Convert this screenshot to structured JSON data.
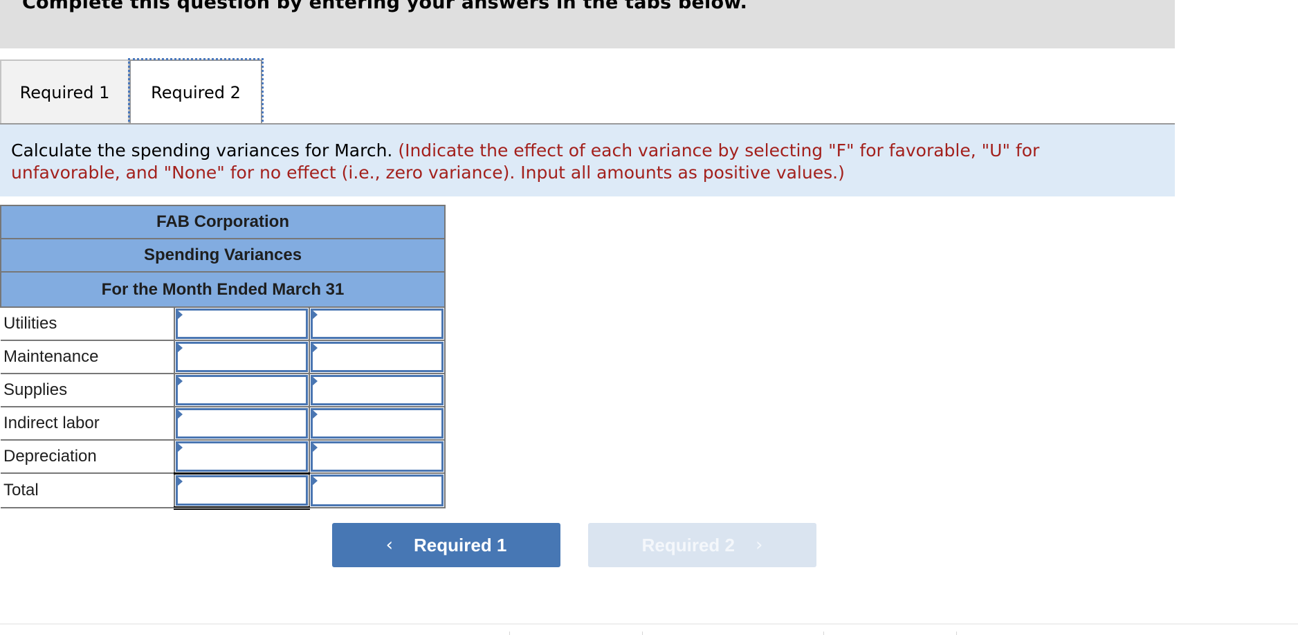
{
  "banner": {
    "title": "Complete this question by entering your answers in the tabs below."
  },
  "tabs": [
    {
      "label": "Required 1",
      "active": false
    },
    {
      "label": "Required 2",
      "active": true
    }
  ],
  "instruction": {
    "main": "Calculate the spending variances for March.",
    "hint": "(Indicate the effect of each variance by selecting \"F\" for favorable, \"U\" for unfavorable, and \"None\" for no effect (i.e., zero variance). Input all amounts as positive values.)"
  },
  "report": {
    "company": "FAB Corporation",
    "title": "Spending Variances",
    "period": "For the Month Ended March 31",
    "rows": [
      {
        "label": "Utilities",
        "amount": "",
        "effect": ""
      },
      {
        "label": "Maintenance",
        "amount": "",
        "effect": ""
      },
      {
        "label": "Supplies",
        "amount": "",
        "effect": ""
      },
      {
        "label": "Indirect labor",
        "amount": "",
        "effect": ""
      },
      {
        "label": "Depreciation",
        "amount": "",
        "effect": ""
      },
      {
        "label": "Total",
        "amount": "",
        "effect": ""
      }
    ]
  },
  "navigation": {
    "prev_label": "Required 1",
    "prev_icon": "chevron-left-icon",
    "next_label": "Required 2",
    "next_icon": "chevron-right-icon",
    "next_disabled": true
  },
  "colors": {
    "header_fill": "#82ace0",
    "input_border": "#4a76b2",
    "hint_text": "#a3201c",
    "instruction_bg": "#ddeaf7",
    "primary_button": "#4777b4",
    "disabled_button": "#dae4f0"
  }
}
